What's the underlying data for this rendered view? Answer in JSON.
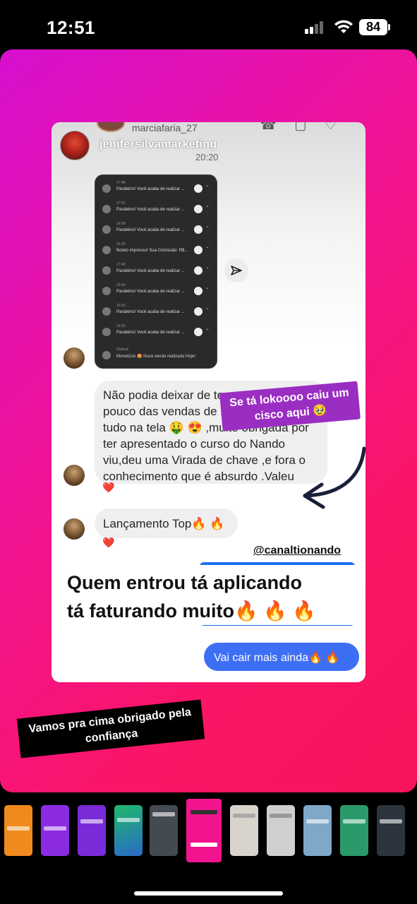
{
  "status_bar": {
    "time": "12:51",
    "battery": "84"
  },
  "screenshot": {
    "top_username": "marciafaria_27",
    "username": "jenifersilvamarketing",
    "time": "20:20",
    "notifications": [
      {
        "time": "17:48",
        "text": "Parabéns! Você acaba de realizar ..."
      },
      {
        "time": "17:51",
        "text": "Parabéns! Você acaba de realizar ..."
      },
      {
        "time": "16:58",
        "text": "Parabéns! Você acaba de realizar ..."
      },
      {
        "time": "16:29",
        "text": "Boleto impresso! Sua Comissão: R$..."
      },
      {
        "time": "17:48",
        "text": "Parabéns! Você acaba de realizar ..."
      },
      {
        "time": "15:54",
        "text": "Parabéns! Você acaba de realizar ..."
      },
      {
        "time": "15:50",
        "text": "Parabéns! Você acaba de realizar ..."
      },
      {
        "time": "14:50",
        "text": "Parabéns! Você acaba de realizar ..."
      },
      {
        "time": "Outlook",
        "text": "Monetizze 🤩 Nova venda realizada Hoje!"
      }
    ],
    "message_1": "Não podia deixar de te mandar ,um pouco das vendas de hoje, não coube tudo na tela 🤑 😍 ,muito obrigada por ter apresentado o curso do Nando viu,deu uma Virada de chave ,e fora o conhecimento que é absurdo .Valeu",
    "heart": "❤️",
    "message_2": "Lançamento Top🔥 🔥",
    "quote_handle": "@canaltionando",
    "quote_line_1": "Quem entrou tá aplicando",
    "quote_line_2": "tá faturando muito🔥 🔥 🔥",
    "reply": "Vai cair mais ainda🔥 🔥"
  },
  "stickers": {
    "purple": "Se tá lokoooo caiu um cisco aqui 🥹",
    "black": "Vamos pra cima obrigado pela confiança"
  },
  "colors": {
    "story_pink": "#f2148f",
    "story_magenta": "#d70fcf",
    "reply_blue": "#3d6ff5",
    "sticker_purple": "#9b2ec2"
  },
  "thumbnails": [
    {
      "name": "thumb-1",
      "color": "#f08a1c"
    },
    {
      "name": "thumb-2",
      "color": "#8a2be2"
    },
    {
      "name": "thumb-3",
      "color": "#7a2bd8"
    },
    {
      "name": "thumb-4",
      "color": "#1fb86a"
    },
    {
      "name": "thumb-5",
      "color": "#444a52"
    },
    {
      "name": "thumb-6",
      "color": "#f2148f"
    },
    {
      "name": "thumb-7",
      "color": "#d8d4cc"
    },
    {
      "name": "thumb-8",
      "color": "#cfcfcf"
    },
    {
      "name": "thumb-9",
      "color": "#7fa7c8"
    },
    {
      "name": "thumb-10",
      "color": "#2a9a6a"
    },
    {
      "name": "thumb-11",
      "color": "#2c3440"
    }
  ]
}
